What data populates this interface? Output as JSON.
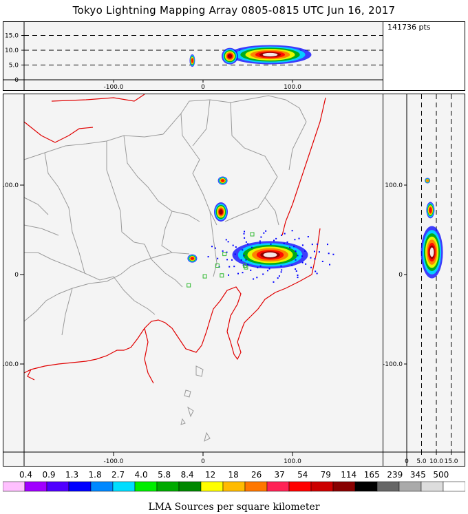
{
  "title": "Tokyo Lightning Mapping Array   0805-0815 UTC  Jun 16, 2017",
  "points_label": "141736 pts",
  "caption": "LMA Sources per square kilometer",
  "colors": {
    "coast": "#e00000",
    "border": "#9a9a9a",
    "panel_bg": "#f4f4f4",
    "station": "#2eb82e"
  },
  "chart_data": [
    {
      "type": "heatmap",
      "panel": "plan-view",
      "xlabel": "",
      "ylabel": "",
      "xlim": [
        -195,
        200
      ],
      "ylim": [
        -200,
        200
      ],
      "x_ticks": [
        -100,
        0,
        100
      ],
      "x_tick_labels": [
        "-100.0",
        "0",
        "100.0"
      ],
      "y_ticks": [
        100,
        0,
        -100
      ],
      "y_tick_labels": [
        "100.0",
        "0",
        "-100.0"
      ],
      "grid": false,
      "storm_cells": [
        {
          "x": 75,
          "y": 22,
          "density": "very high"
        },
        {
          "x": 20,
          "y": 70,
          "density": "high"
        },
        {
          "x": 22,
          "y": 105,
          "density": "medium"
        },
        {
          "x": -12,
          "y": 18,
          "density": "medium"
        }
      ],
      "stations": [
        {
          "x": 55,
          "y": 45
        },
        {
          "x": 24,
          "y": 23
        },
        {
          "x": 47,
          "y": 10
        },
        {
          "x": 2,
          "y": -2
        },
        {
          "x": 21,
          "y": -1
        },
        {
          "x": 48,
          "y": 8
        },
        {
          "x": -16,
          "y": -12
        },
        {
          "x": 16,
          "y": 10
        }
      ]
    },
    {
      "type": "heatmap",
      "panel": "altitude-vs-x",
      "xlim": [
        -195,
        200
      ],
      "ylim": [
        0,
        20
      ],
      "x_ticks": [
        -100,
        0,
        100
      ],
      "x_tick_labels": [
        "-100.0",
        "0",
        "100.0"
      ],
      "y_ticks": [
        15,
        10,
        5,
        0
      ],
      "y_tick_labels": [
        "15.0",
        "10.0",
        "5.0",
        "0"
      ],
      "reference_altitudes": [
        15,
        10,
        5
      ]
    },
    {
      "type": "heatmap",
      "panel": "y-vs-altitude",
      "xlim": [
        -2,
        20
      ],
      "ylim": [
        -200,
        200
      ],
      "x_ticks": [
        0,
        5,
        10,
        15
      ],
      "x_tick_labels": [
        "0",
        "5.0",
        "10.0",
        "15.0"
      ],
      "y_ticks": [
        100,
        0,
        -100
      ],
      "y_tick_labels": [
        "100.0",
        "0",
        "-100.0"
      ],
      "reference_altitudes": [
        5,
        10,
        15
      ]
    },
    {
      "type": "colorbar",
      "panel": "legend",
      "labels": [
        "0.4",
        "0.9",
        "1.3",
        "1.8",
        "2.7",
        "4.0",
        "5.8",
        "8.4",
        "12",
        "18",
        "26",
        "37",
        "54",
        "79",
        "114",
        "165",
        "239",
        "345",
        "500"
      ],
      "colors": [
        "#ffc0ff",
        "#a000ff",
        "#5000ff",
        "#0000ff",
        "#0088ff",
        "#00ddff",
        "#00ee00",
        "#00aa00",
        "#008800",
        "#ffff00",
        "#ffbb00",
        "#ff7700",
        "#ff2255",
        "#ff0000",
        "#cc0000",
        "#880000",
        "#000000",
        "#666666",
        "#aaaaaa",
        "#dddddd",
        "#ffffff"
      ]
    }
  ]
}
